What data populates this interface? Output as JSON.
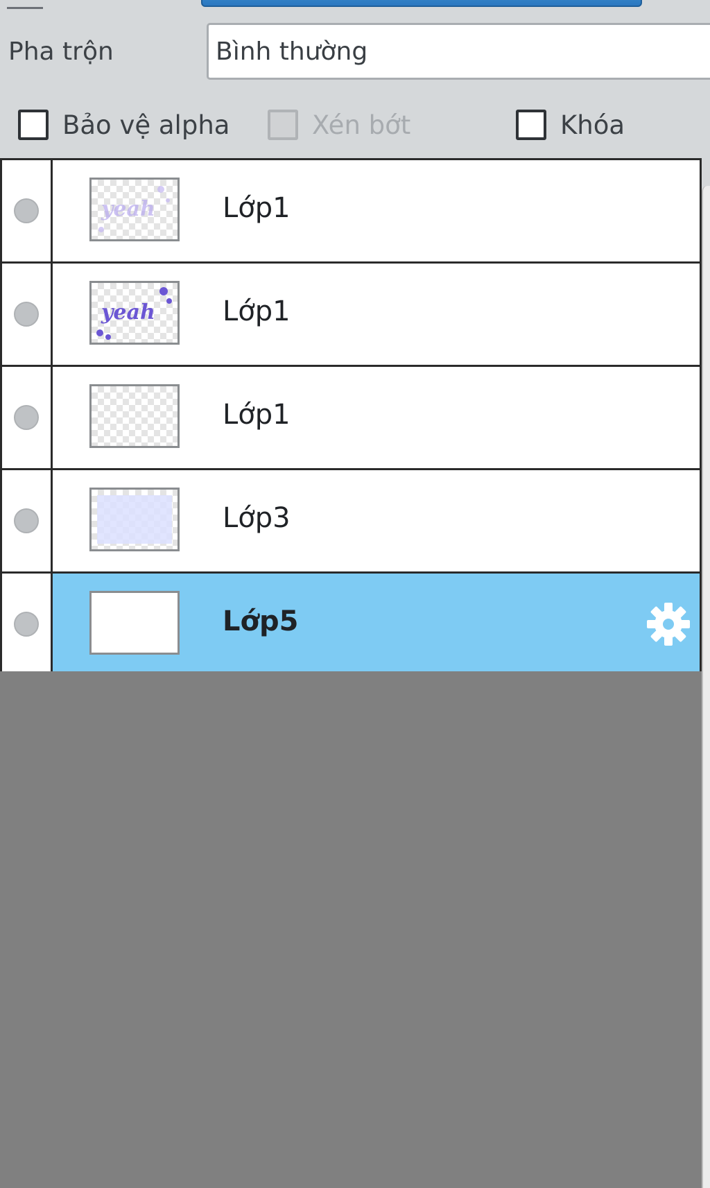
{
  "blend": {
    "label": "Pha trộn",
    "value": "Bình thường"
  },
  "options": [
    {
      "label": "Bảo vệ alpha",
      "checked": false,
      "disabled": false
    },
    {
      "label": "Xén bớt",
      "checked": false,
      "disabled": true
    },
    {
      "label": "Khóa",
      "checked": false,
      "disabled": false
    }
  ],
  "layers": [
    {
      "name": "Lớp1",
      "thumb": "faded-yeah-text",
      "active": false
    },
    {
      "name": "Lớp1",
      "thumb": "purple-yeah-text",
      "active": false
    },
    {
      "name": "Lớp1",
      "thumb": "transparent",
      "active": false
    },
    {
      "name": "Lớp3",
      "thumb": "light-lavender-fill",
      "active": false
    },
    {
      "name": "Lớp5",
      "thumb": "white-fill",
      "active": true,
      "icon": "gear-icon"
    }
  ],
  "colors": {
    "panel_bg": "#d5d8da",
    "selected_row": "#7ecbf3",
    "empty_area": "#808080",
    "slider_accent": "#2b78c0"
  }
}
